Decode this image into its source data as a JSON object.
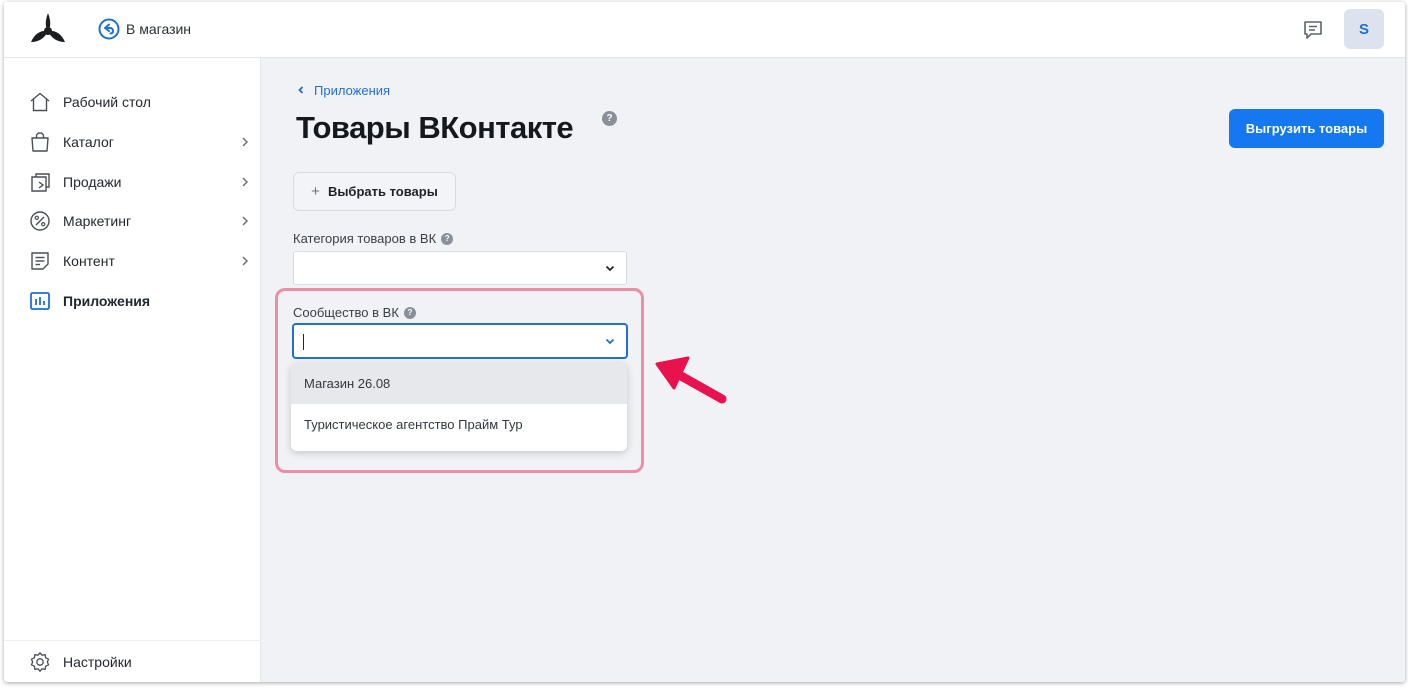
{
  "header": {
    "back_label": "В магазин",
    "avatar_letter": "S"
  },
  "sidebar": {
    "items": [
      {
        "label": "Рабочий стол",
        "icon": "home-icon"
      },
      {
        "label": "Каталог",
        "icon": "bag-icon"
      },
      {
        "label": "Продажи",
        "icon": "sales-icon"
      },
      {
        "label": "Маркетинг",
        "icon": "percent-icon"
      },
      {
        "label": "Контент",
        "icon": "document-icon"
      },
      {
        "label": "Приложения",
        "icon": "apps-chart-icon"
      }
    ],
    "settings_label": "Настройки"
  },
  "main": {
    "breadcrumb": "Приложения",
    "title": "Товары ВКонтакте",
    "export_button": "Выгрузить товары",
    "select_products_button": "Выбрать товары",
    "category_label": "Категория товаров в ВК",
    "category_value": "",
    "community_label": "Сообщество в ВК",
    "community_value": "",
    "community_options": [
      "Магазин 26.08",
      "Туристическое агентство Прайм Тур"
    ]
  },
  "colors": {
    "accent": "#1578f0",
    "highlight": "#ee8ea3",
    "arrow": "#e8124e"
  }
}
